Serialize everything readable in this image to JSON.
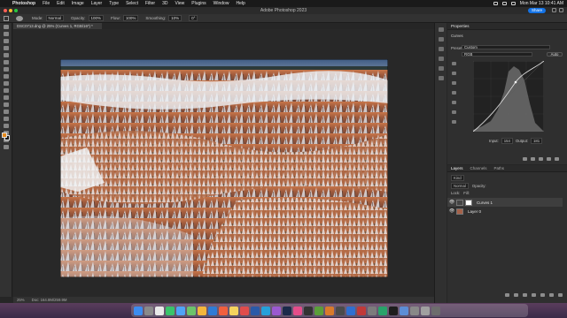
{
  "menubar": {
    "apple_glyph": "",
    "items": [
      "Photoshop",
      "File",
      "Edit",
      "Image",
      "Layer",
      "Type",
      "Select",
      "Filter",
      "3D",
      "View",
      "Plugins",
      "Window",
      "Help"
    ],
    "clock": "Mon Mar 13  10:41 AM"
  },
  "titlebar": {
    "title": "Adobe Photoshop 2023",
    "share_label": "Share"
  },
  "options": {
    "mode_label": "Mode:",
    "mode_value": "Normal",
    "opacity_label": "Opacity:",
    "opacity_value": "100%",
    "flow_label": "Flow:",
    "flow_value": "100%",
    "smoothing_label": "Smoothing:",
    "smoothing_value": "10%",
    "angle_value": "0°"
  },
  "document": {
    "tab_label": "DSC0713.dng @ 25% (Curves 1, RGB/16*) *",
    "status_zoom": "25%",
    "status_doc": "Doc: 164.8M/259.9M"
  },
  "properties": {
    "title": "Properties",
    "adjustment_name": "Curves",
    "preset_label": "Preset:",
    "preset_value": "Custom",
    "channel_value": "RGB",
    "auto_label": "Auto",
    "input_label": "Input:",
    "input_value": "154",
    "output_label": "Output:",
    "output_value": "181"
  },
  "layers": {
    "tabs": [
      "Layers",
      "Channels",
      "Paths"
    ],
    "kind_label": "Kind",
    "blend_value": "Normal",
    "opacity_label": "Opacity:",
    "lock_label": "Lock:",
    "fill_label": "Fill:",
    "items": [
      {
        "name": "Curves 1",
        "selected": true
      },
      {
        "name": "Layer 0",
        "selected": false
      }
    ]
  },
  "colors": {
    "accent": "#1473e6",
    "foreground_swatch": "#e58a1d",
    "background_swatch": "#1a1a1a"
  }
}
